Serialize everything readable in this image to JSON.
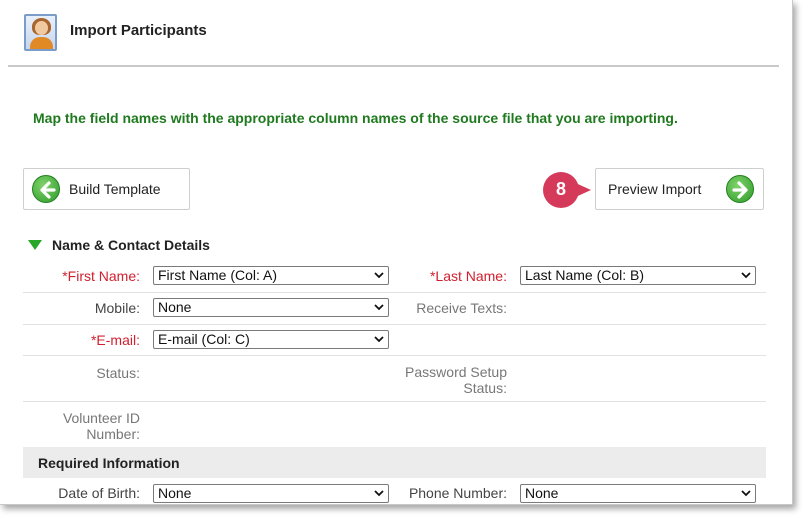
{
  "header": {
    "title": "Import Participants"
  },
  "instruction": "Map the field names with the appropriate column names of the source file that you are importing.",
  "buttons": {
    "back_label": "Build Template",
    "next_label": "Preview Import"
  },
  "step_badge": "8",
  "section": {
    "title": "Name & Contact Details"
  },
  "fields": {
    "first_name": {
      "label": "*First Name:",
      "value": "First Name (Col: A)"
    },
    "last_name": {
      "label": "*Last Name:",
      "value": "Last Name (Col: B)"
    },
    "mobile": {
      "label": "Mobile:",
      "value": "None"
    },
    "receive_texts": {
      "label": "Receive Texts:"
    },
    "email": {
      "label": "*E-mail:",
      "value": "E-mail (Col: C)"
    },
    "status": {
      "label": "Status:"
    },
    "password_setup": {
      "label": "Password Setup Status:"
    },
    "volunteer_id": {
      "label": "Volunteer ID Number:"
    },
    "date_of_birth": {
      "label": "Date of Birth:",
      "value": "None"
    },
    "phone_number": {
      "label": "Phone Number:",
      "value": "None"
    }
  },
  "required_section": {
    "title": "Required Information"
  },
  "colors": {
    "accent_green": "#1f7a1f",
    "required_red": "#d0202f",
    "badge": "#d63a5a"
  },
  "icons": [
    "avatar-icon",
    "arrow-left-icon",
    "arrow-right-icon",
    "triangle-down-icon",
    "chevron-down-icon"
  ]
}
